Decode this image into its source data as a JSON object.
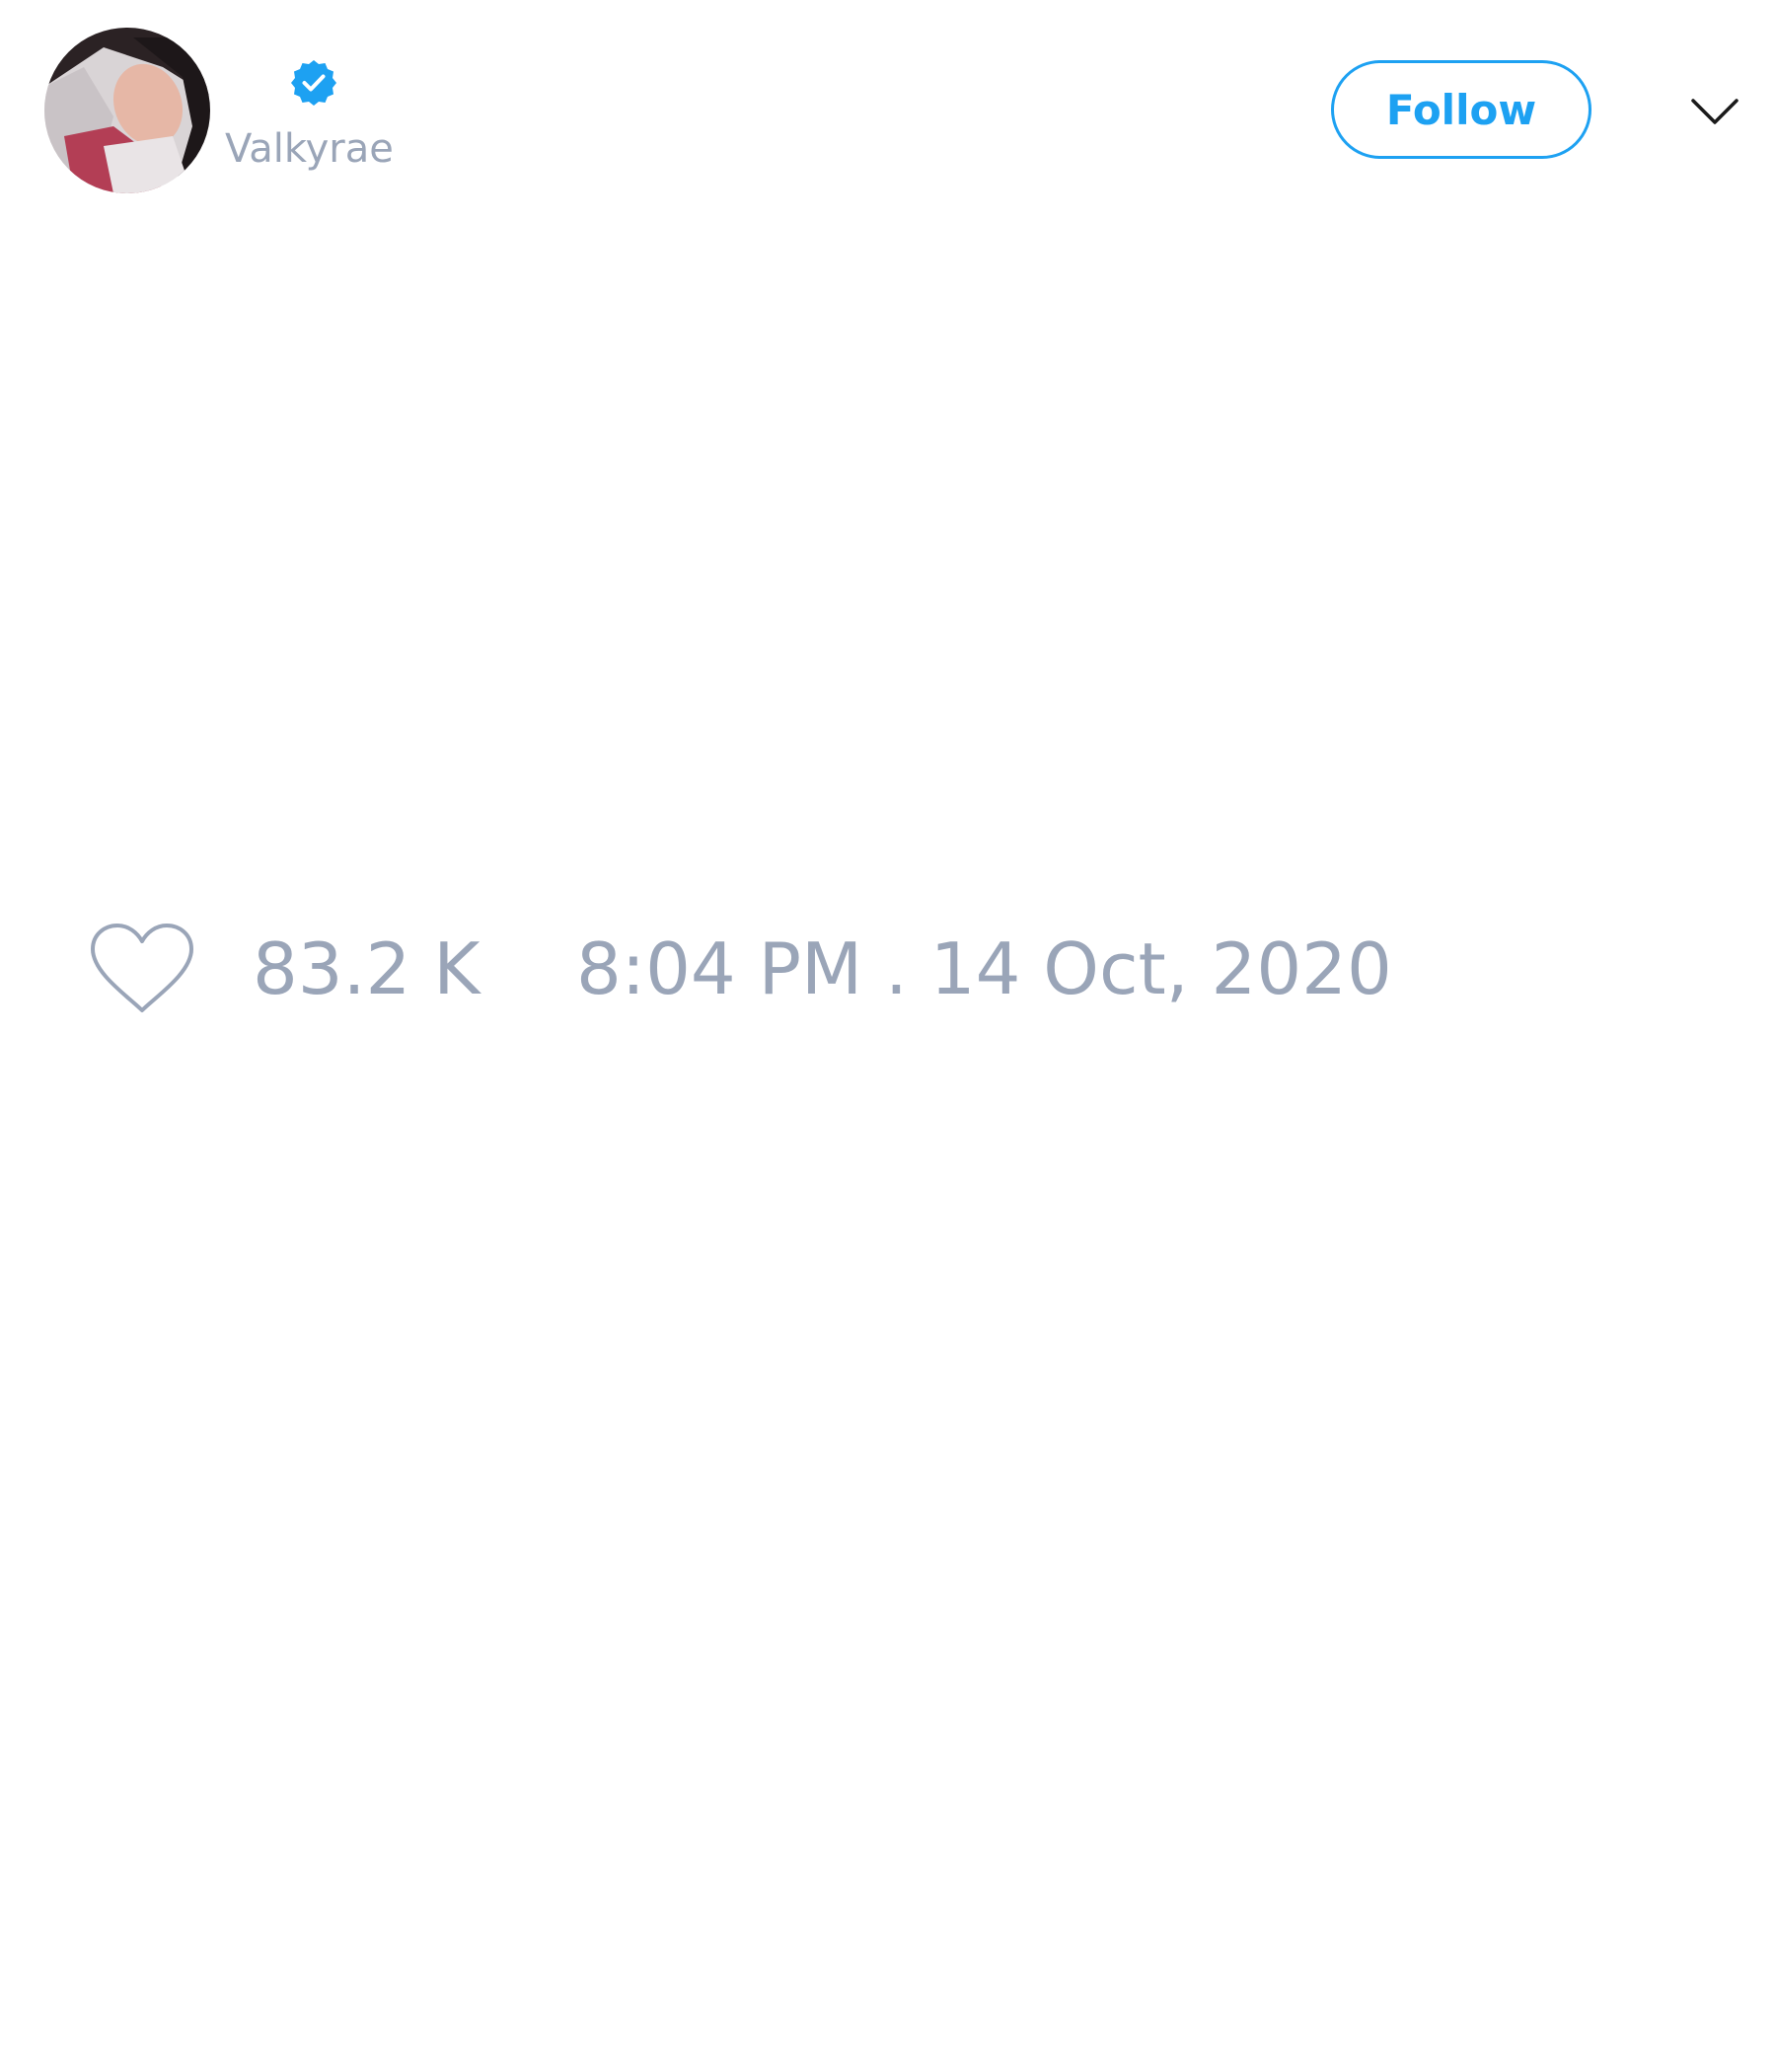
{
  "tweet": {
    "author": {
      "handle": "Valkyrae",
      "verified": true,
      "avatar_icon": "user-avatar-photo"
    },
    "follow_label": "Follow",
    "menu_icon": "chevron-down-icon",
    "likes": {
      "icon": "heart-icon",
      "count": "83.2 K"
    },
    "timestamp": "8:04 PM . 14 Oct, 2020"
  },
  "colors": {
    "accent": "#1da1f2",
    "muted_text": "#9aa5b8",
    "background": "#ffffff"
  }
}
